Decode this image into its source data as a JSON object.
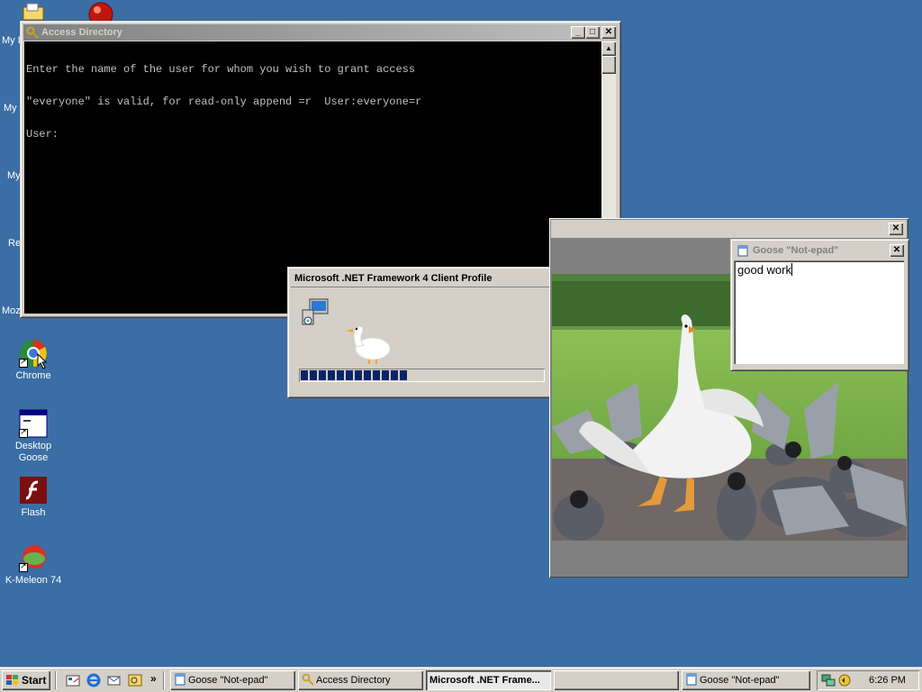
{
  "desktop": {
    "partial_labels": [
      "My D",
      "My",
      "My",
      "Re",
      "Moz"
    ],
    "icons": [
      {
        "label": "Chrome",
        "icon": "chrome-icon"
      },
      {
        "label": "Desktop\nGoose",
        "line1": "Desktop",
        "line2": "Goose",
        "icon": "goose-app-icon"
      },
      {
        "label": "Flash",
        "icon": "flash-icon"
      },
      {
        "label": "K-Meleon 74",
        "icon": "kmeleon-icon"
      }
    ]
  },
  "console_window": {
    "title": "Access Directory",
    "lines": [
      "Enter the name of the user for whom you wish to grant access",
      "\"everyone\" is valid, for read-only append =r  User:everyone=r",
      "User:"
    ]
  },
  "installer_window": {
    "title": "Microsoft .NET Framework 4 Client Profile",
    "progress_fraction": 0.48,
    "progress_blocks": 12
  },
  "goose_image_window": {
    "title": "",
    "image_description_icon": "goose-with-pigeons-image"
  },
  "notepad_window": {
    "title": "Goose \"Not-epad\"",
    "text": "good work"
  },
  "taskbar": {
    "start_label": "Start",
    "quicklaunch_icons": [
      "show-desktop-icon",
      "internet-explorer-icon",
      "outlook-express-icon",
      "media-icon"
    ],
    "overflow": "»",
    "buttons": [
      {
        "label": "Goose \"Not-epad\"",
        "pressed": false
      },
      {
        "label": "Access Directory",
        "pressed": false
      },
      {
        "label": "Microsoft .NET Frame...",
        "pressed": true
      },
      {
        "label": "",
        "pressed": false
      },
      {
        "label": "Goose \"Not-epad\"",
        "pressed": false
      }
    ],
    "clock": "6:26 PM"
  },
  "colors": {
    "desktop": "#3a6ea5",
    "active_title": "#0a246a",
    "inactive_title": "#808080",
    "progress": "#0a246a"
  }
}
